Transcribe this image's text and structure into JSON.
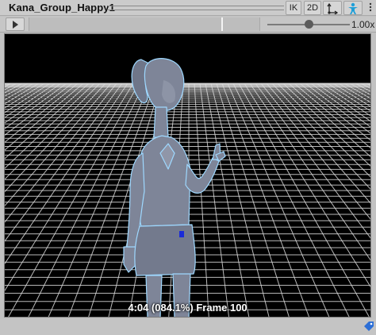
{
  "header": {
    "clip_name": "Kana_Group_Happy1",
    "ik_label": "IK",
    "twod_label": "2D",
    "pivot_icon": "pivot-move-icon",
    "avatar_icon": "avatar-body-icon",
    "menu_icon": "context-menu-icon"
  },
  "playbar": {
    "play_icon": "play-icon",
    "playhead_progress": 0.841,
    "speed_value": "1.00x",
    "speed_fraction": 0.5
  },
  "viewport": {
    "status_text": "4:04 (084.1%) Frame 100",
    "background": "#000000",
    "grid_color": "#d9d9d9",
    "model_color": "#7e8598",
    "model_outline": "#9ed8ff"
  },
  "footer": {
    "tag_icon": "asset-label-icon",
    "tag_color": "#2d6fd6"
  }
}
